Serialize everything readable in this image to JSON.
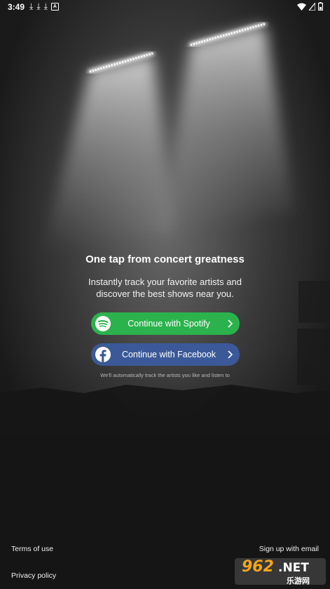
{
  "status_bar": {
    "time": "3:49",
    "left_icons": [
      "download-icon",
      "download-icon",
      "download-icon",
      "a-app-icon"
    ],
    "right_icons": [
      "wifi-icon",
      "signal-icon",
      "battery-icon"
    ]
  },
  "headline": "One tap from concert greatness",
  "subtitle": {
    "line1": "Instantly track your favorite artists and",
    "line2": "discover the best shows near you."
  },
  "buttons": {
    "spotify": {
      "label": "Continue with Spotify",
      "color": "#2bb24c",
      "icon": "spotify-icon"
    },
    "facebook": {
      "label": "Continue with Facebook",
      "color": "#3b5998",
      "icon": "facebook-icon"
    }
  },
  "disclaimer": "We'll automatically track the artists you like and listen to",
  "footer": {
    "terms": "Terms of use",
    "privacy": "Privacy policy",
    "signup": "Sign up with email"
  },
  "watermark": {
    "main": "962",
    "suffix": ".NET",
    "sub": "乐游网"
  }
}
